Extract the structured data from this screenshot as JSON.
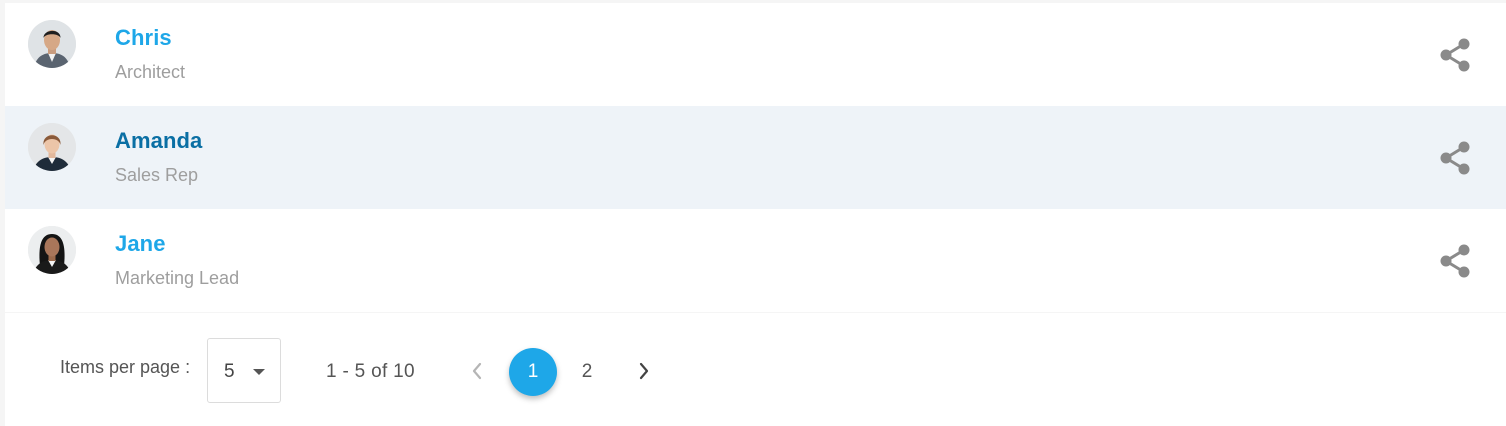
{
  "people": [
    {
      "name": "Chris",
      "role": "Architect",
      "avatar_icon": "person-avatar-man",
      "share_icon": "share-icon"
    },
    {
      "name": "Amanda",
      "role": "Sales Rep",
      "avatar_icon": "person-avatar-woman",
      "share_icon": "share-icon"
    },
    {
      "name": "Jane",
      "role": "Marketing Lead",
      "avatar_icon": "person-avatar-woman",
      "share_icon": "share-icon"
    }
  ],
  "pager": {
    "items_per_page_label": "Items per page :",
    "items_per_page_value": "5",
    "range_text": "1 - 5 of 10",
    "pages": [
      "1",
      "2"
    ],
    "active_page": "1",
    "prev_icon": "chevron-left-icon",
    "next_icon": "chevron-right-icon"
  },
  "colors": {
    "accent": "#1ea7e8",
    "selected_name": "#0a6fa4",
    "selected_row_bg": "#eef3f8",
    "secondary_text": "#9e9e9e",
    "icon_gray": "#8a8a8a"
  }
}
